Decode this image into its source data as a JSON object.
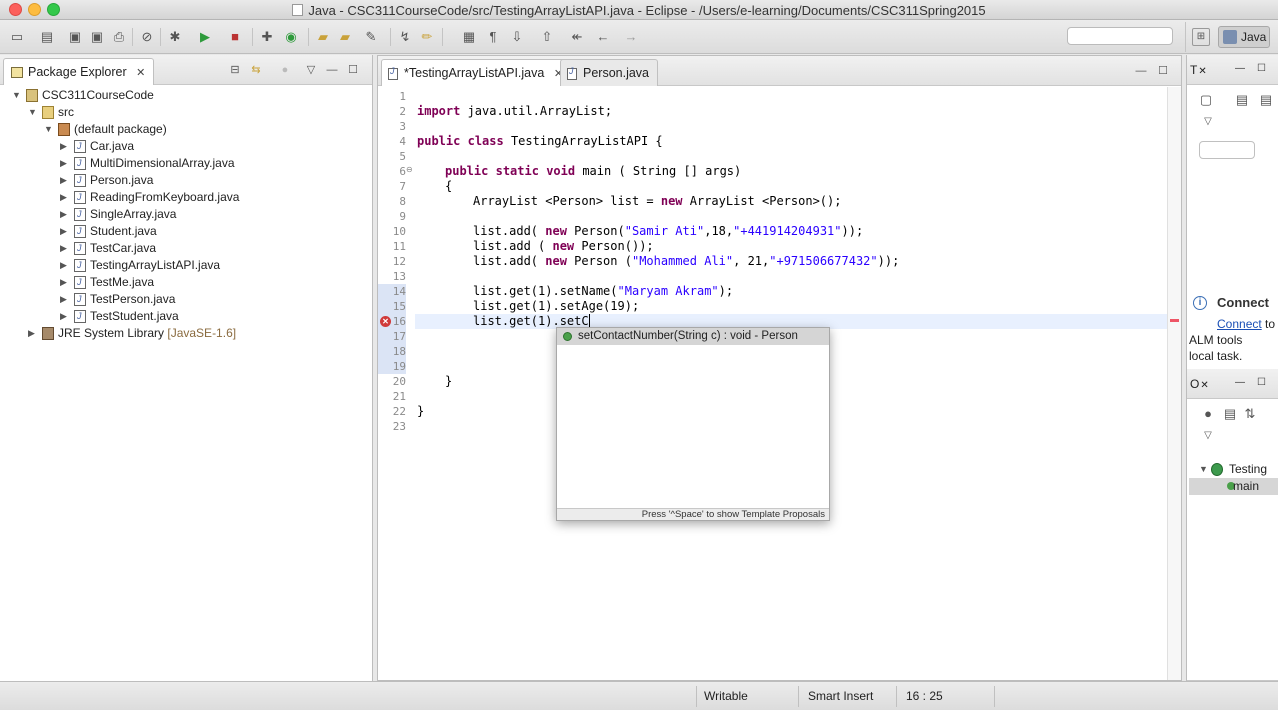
{
  "window": {
    "title": "Java - CSC311CourseCode/src/TestingArrayListAPI.java - Eclipse - /Users/e-learning/Documents/CSC311Spring2015"
  },
  "perspective": {
    "label": "Java"
  },
  "package_explorer": {
    "tab_label": "Package Explorer",
    "tree": [
      {
        "label": "CSC311CourseCode",
        "kind": "project",
        "expanded": true
      },
      {
        "label": "src",
        "kind": "src",
        "expanded": true
      },
      {
        "label": "(default package)",
        "kind": "package",
        "expanded": true
      },
      {
        "label": "Car.java",
        "kind": "java"
      },
      {
        "label": "MultiDimensionalArray.java",
        "kind": "java"
      },
      {
        "label": "Person.java",
        "kind": "java"
      },
      {
        "label": "ReadingFromKeyboard.java",
        "kind": "java"
      },
      {
        "label": "SingleArray.java",
        "kind": "java"
      },
      {
        "label": "Student.java",
        "kind": "java"
      },
      {
        "label": "TestCar.java",
        "kind": "java"
      },
      {
        "label": "TestingArrayListAPI.java",
        "kind": "java"
      },
      {
        "label": "TestMe.java",
        "kind": "java"
      },
      {
        "label": "TestPerson.java",
        "kind": "java"
      },
      {
        "label": "TestStudent.java",
        "kind": "java"
      },
      {
        "label": "JRE System Library",
        "suffix": "[JavaSE-1.6]",
        "kind": "library"
      }
    ]
  },
  "editor": {
    "tabs": [
      {
        "label": "*TestingArrayListAPI.java",
        "active": true
      },
      {
        "label": "Person.java",
        "active": false
      }
    ],
    "line_numbers": [
      "1",
      "2",
      "3",
      "4",
      "5",
      "6",
      "7",
      "8",
      "9",
      "10",
      "11",
      "12",
      "13",
      "14",
      "15",
      "16",
      "17",
      "18",
      "19",
      "20",
      "21",
      "22",
      "23"
    ],
    "lines": {
      "l2_kw": "import",
      "l2_rest": " java.util.ArrayList;",
      "l4_kw1": "public",
      "l4_kw2": "class",
      "l4_rest": " TestingArrayListAPI {",
      "l6_kw1": "public",
      "l6_kw2": "static",
      "l6_kw3": "void",
      "l6_rest": " main ( String [] args)",
      "l7": "{",
      "l8_a": "ArrayList <Person> list = ",
      "l8_kw": "new",
      "l8_b": " ArrayList <Person>();",
      "l10_a": "list.add( ",
      "l10_kw": "new",
      "l10_b": " Person(",
      "l10_s1": "\"Samir Ati\"",
      "l10_c": ",18,",
      "l10_s2": "\"+441914204931\"",
      "l10_d": "));",
      "l11_a": "list.add ( ",
      "l11_kw": "new",
      "l11_b": " Person());",
      "l12_a": "list.add( ",
      "l12_kw": "new",
      "l12_b": " Person (",
      "l12_s1": "\"Mohammed Ali\"",
      "l12_c": ", 21,",
      "l12_s2": "\"+971506677432\"",
      "l12_d": "));",
      "l14_a": "list.get(1).setName(",
      "l14_s": "\"Maryam Akram\"",
      "l14_b": ");",
      "l15": "list.get(1).setAge(19);",
      "l16_a": "list.get(1).",
      "l16_b": "setC",
      "l20": "}",
      "l22": "}"
    }
  },
  "content_assist": {
    "proposal": "setContactNumber(String c) : void - Person",
    "footer": "Press '^Space' to show Template Proposals"
  },
  "right_panel": {
    "task_tab": "T",
    "connect_title": "Connect",
    "connect_link": "Connect",
    "connect_link_tail": "to",
    "connect_line2": "ALM tools",
    "connect_line3": "local task.",
    "outline_tab": "O",
    "outline_class": "Testing",
    "outline_method": "main"
  },
  "status_bar": {
    "writable": "Writable",
    "insert_mode": "Smart Insert",
    "position": "16 : 25"
  }
}
